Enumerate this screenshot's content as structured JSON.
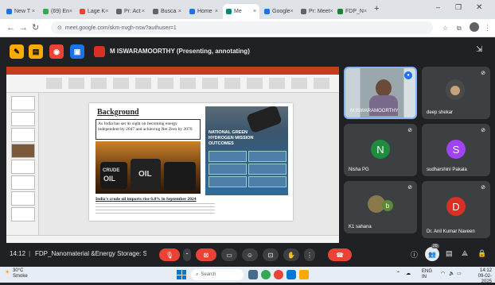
{
  "browser": {
    "tabs": [
      {
        "label": "New T",
        "color": "#1a73e8"
      },
      {
        "label": "(69) En",
        "color": "#34a853"
      },
      {
        "label": "Lage K",
        "color": "#ea4335"
      },
      {
        "label": "Pr: Act",
        "color": "#5f6368"
      },
      {
        "label": "Busca",
        "color": "#5f6368"
      },
      {
        "label": "Home",
        "color": "#1a73e8"
      },
      {
        "label": "Me",
        "color": "#00897b"
      },
      {
        "label": "Google",
        "color": "#1a73e8"
      },
      {
        "label": "Pr: Meet",
        "color": "#5f6368"
      },
      {
        "label": "FDP_N",
        "color": "#188038"
      }
    ],
    "url": "meet.google.com/skm-nvgh-nsw?authuser=1"
  },
  "meet": {
    "presenter_label": "M ISWARAMOORTHY (Presenting, annotating)",
    "time": "14:12",
    "meeting_title": "FDP_Nanomaterial &Energy Storage: S...",
    "people_count": "20"
  },
  "slide": {
    "title": "Background",
    "para": "As India has set its sight on becoming energy independent by 2047 and achieving Net Zero by 2070",
    "caption": "India's crude oil imports rise 6.8% in September 2024",
    "right_title": "NATIONAL GREEN HYDROGEN MISSION OUTCOMES",
    "oil_label_1": "CRUDE",
    "oil_label_2": "OIL",
    "oil_label_3": "OIL"
  },
  "participants": [
    {
      "name": "M ISWARAMOORTHY",
      "initial": "",
      "color": "#5b8ba3"
    },
    {
      "name": "deep shekar",
      "initial": "",
      "color": "#4a4a4a"
    },
    {
      "name": "Nisha PG",
      "initial": "N",
      "color": "#1e8e3e"
    },
    {
      "name": "sudharshini Pakala",
      "initial": "S",
      "color": "#a142f4"
    },
    {
      "name": "K1 sahana",
      "initial": "b",
      "color": "#8a7a4a"
    },
    {
      "name": "Dr. Anil Kumar Naveen",
      "initial": "D",
      "color": "#d93025"
    }
  ],
  "taskbar": {
    "weather": "30°C",
    "weather_sub": "Smoke",
    "search": "Search",
    "lang": "ENG IN",
    "clock": "14:12",
    "date": "09-02-2025"
  }
}
